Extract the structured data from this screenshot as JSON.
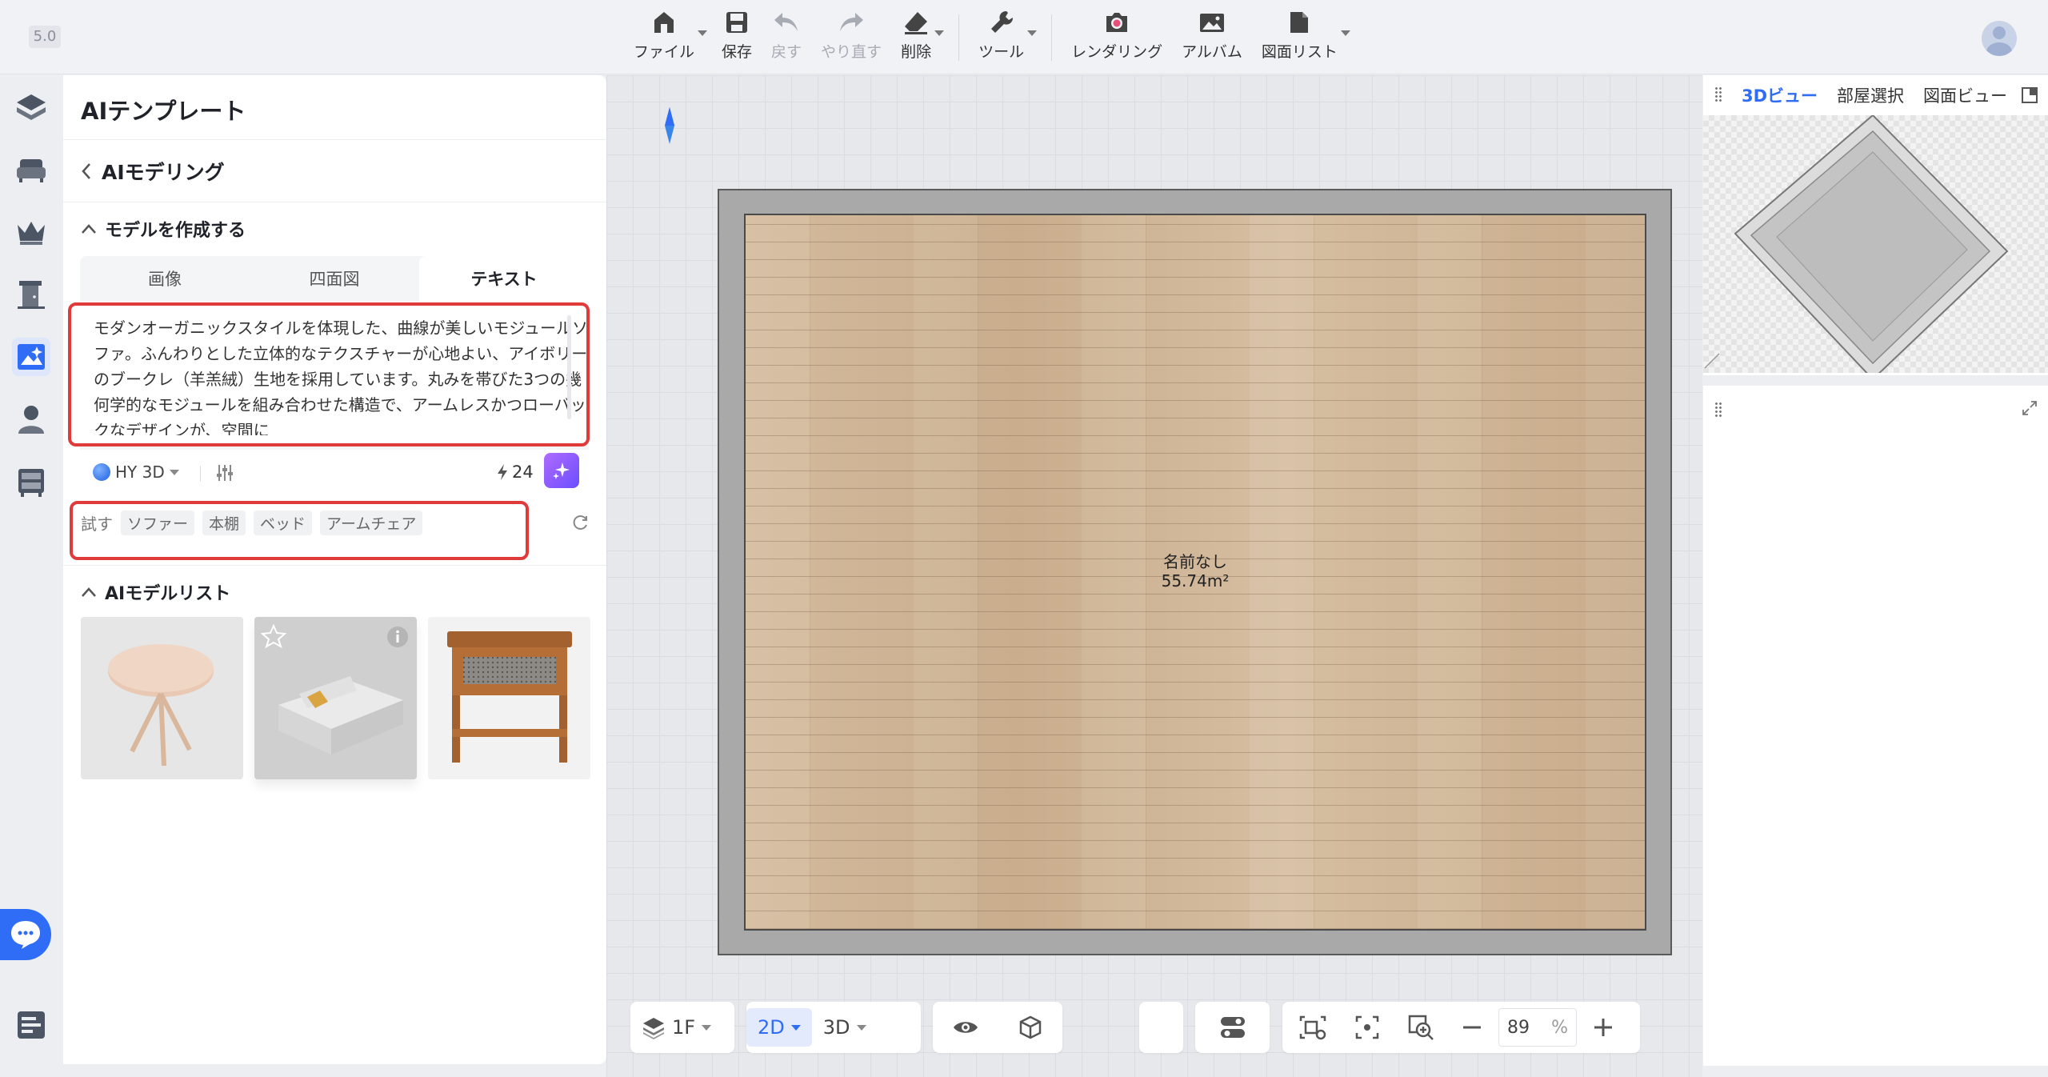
{
  "app": {
    "version": "5.0"
  },
  "toolbar": {
    "file": "ファイル",
    "save": "保存",
    "undo": "戻す",
    "redo": "やり直す",
    "delete": "削除",
    "tools": "ツール",
    "render": "レンダリング",
    "album": "アルバム",
    "drawing_list": "図面リスト"
  },
  "left_rail": {
    "items": [
      "templates-icon",
      "sofa-icon",
      "crown-icon",
      "door-icon",
      "ai-modeling-icon",
      "user-icon",
      "cabinet-icon"
    ],
    "active": "ai-modeling-icon"
  },
  "panel": {
    "title": "AIテンプレート",
    "back_label": "AIモデリング",
    "create_section": "モデルを作成する",
    "tabs": [
      "画像",
      "四面図",
      "テキスト"
    ],
    "active_tab": "テキスト",
    "prompt": "モダンオーガニックスタイルを体現した、曲線が美しいモジュールソファ。ふんわりとした立体的なテクスチャーが心地よい、アイボリーのブークレ（羊羔絨）生地を採用しています。丸みを帯びた3つの幾何学的なモジュールを組み合わせた構造で、アームレスかつローバックなデザインが、空間に",
    "model": "HY 3D",
    "credits": "24",
    "try_label": "試す",
    "suggestions": [
      "ソファー",
      "本棚",
      "ベッド",
      "アームチェア"
    ],
    "model_list_section": "AIモデルリスト"
  },
  "canvas": {
    "room_name": "名前なし",
    "room_area": "55.74m²"
  },
  "bottom_bar": {
    "floor": "1F",
    "view_2d": "2D",
    "view_3d": "3D",
    "zoom": "89",
    "zoom_unit": "%"
  },
  "right_panel": {
    "tabs": [
      "3Dビュー",
      "部屋選択",
      "図面ビュー"
    ],
    "active_tab": "3Dビュー"
  },
  "colors": {
    "accent": "#2f6df6",
    "highlight_box": "#e03b3b",
    "floor_wood": "#cfb496"
  }
}
